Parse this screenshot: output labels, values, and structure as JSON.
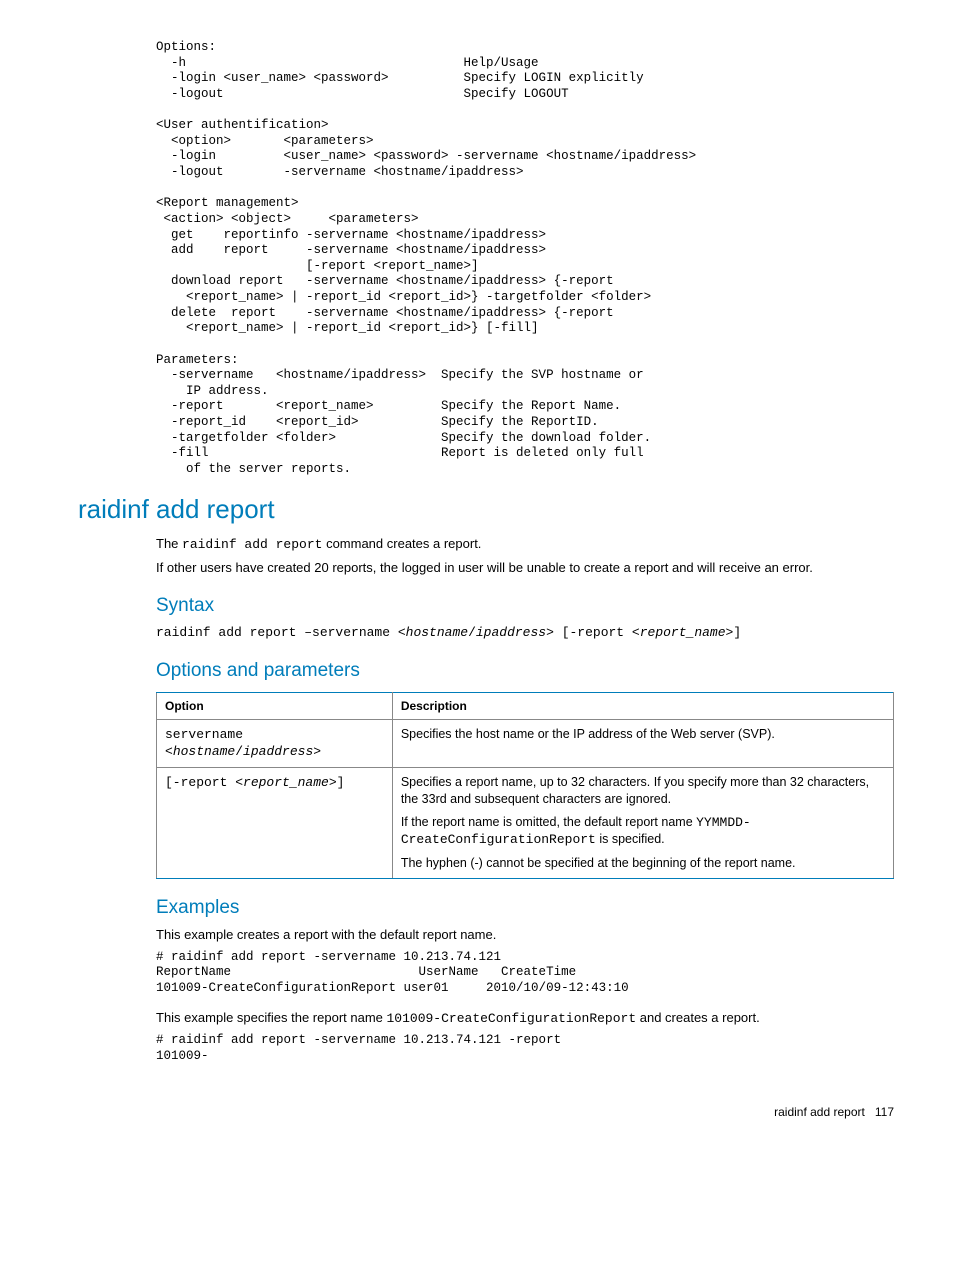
{
  "codeblock1": "Options:\n  -h                                     Help/Usage\n  -login <user_name> <password>          Specify LOGIN explicitly\n  -logout                                Specify LOGOUT\n\n<User authentification>\n  <option>       <parameters>\n  -login         <user_name> <password> -servername <hostname/ipaddress>\n  -logout        -servername <hostname/ipaddress>\n\n<Report management>\n <action> <object>     <parameters>\n  get    reportinfo -servername <hostname/ipaddress>\n  add    report     -servername <hostname/ipaddress>\n                    [-report <report_name>]\n  download report   -servername <hostname/ipaddress> {-report\n    <report_name> | -report_id <report_id>} -targetfolder <folder>\n  delete  report    -servername <hostname/ipaddress> {-report\n    <report_name> | -report_id <report_id>} [-fill]\n\nParameters:\n  -servername   <hostname/ipaddress>  Specify the SVP hostname or\n    IP address.\n  -report       <report_name>         Specify the Report Name.\n  -report_id    <report_id>           Specify the ReportID.\n  -targetfolder <folder>              Specify the download folder.\n  -fill                               Report is deleted only full\n    of the server reports.",
  "h1": "raidinf add report",
  "intro": {
    "p1_a": "The ",
    "p1_code": "raidinf add report",
    "p1_b": " command creates a report.",
    "p2": "If other users have created 20 reports, the logged in user will be unable to create a report and will receive an error."
  },
  "syntax": {
    "heading": "Syntax",
    "line_a": "raidinf add report –servername <",
    "line_em1": "hostname",
    "line_b": "/",
    "line_em2": "ipaddress",
    "line_c": "> [-report <",
    "line_em3": "report_name",
    "line_d": ">]"
  },
  "options": {
    "heading": "Options and parameters",
    "th1": "Option",
    "th2": "Description",
    "row1": {
      "opt_a": "servername <",
      "opt_em1": "hostname",
      "opt_b": "/",
      "opt_em2": "ipaddress",
      "opt_c": ">",
      "desc": "Specifies the host name or the IP address of the Web server (SVP)."
    },
    "row2": {
      "opt_a": "[-report <",
      "opt_em1": "report_name",
      "opt_b": ">]",
      "desc_p1": "Specifies a report name, up to 32 characters. If you specify more than 32 characters, the 33rd and subsequent characters are ignored.",
      "desc_p2a": "If the report name is omitted, the default report name ",
      "desc_p2code": "YYMMDD-CreateConfigurationReport",
      "desc_p2b": " is specified.",
      "desc_p3": "The hyphen (-) cannot be specified at the beginning of the report name."
    }
  },
  "examples": {
    "heading": "Examples",
    "p1": "This example creates a report with the default report name.",
    "code1": "# raidinf add report -servername 10.213.74.121\nReportName                         UserName   CreateTime\n101009-CreateConfigurationReport user01     2010/10/09-12:43:10",
    "p2a": "This example specifies the report name ",
    "p2code": "101009-CreateConfigurationReport",
    "p2b": " and creates a report.",
    "code2": "# raidinf add report -servername 10.213.74.121 -report \n101009-"
  },
  "footer": {
    "title": "raidinf add report",
    "page": "117"
  }
}
